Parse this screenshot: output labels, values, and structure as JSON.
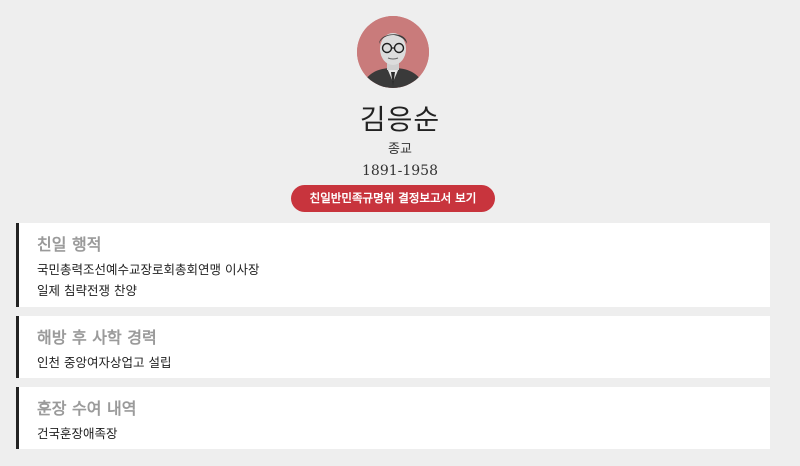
{
  "profile": {
    "avatar_label": "portrait-photo",
    "name": "김응순",
    "field": "종교",
    "years": "1891-1958",
    "report_button": "친일반민족규명위 결정보고서 보기"
  },
  "sections": [
    {
      "title": "친일 행적",
      "lines": [
        "국민총력조선예수교장로회총회연맹 이사장",
        "일제 침략전쟁 찬양"
      ]
    },
    {
      "title": "해방 후 사학 경력",
      "lines": [
        "인천 중앙여자상업고 설립"
      ]
    },
    {
      "title": "훈장 수여 내역",
      "lines": [
        "건국훈장애족장"
      ]
    }
  ],
  "colors": {
    "background": "#eeeeee",
    "accent": "#c8343d",
    "avatar_bg": "#c97b7b",
    "card_border": "#222222",
    "section_title": "#9a9a9a"
  }
}
